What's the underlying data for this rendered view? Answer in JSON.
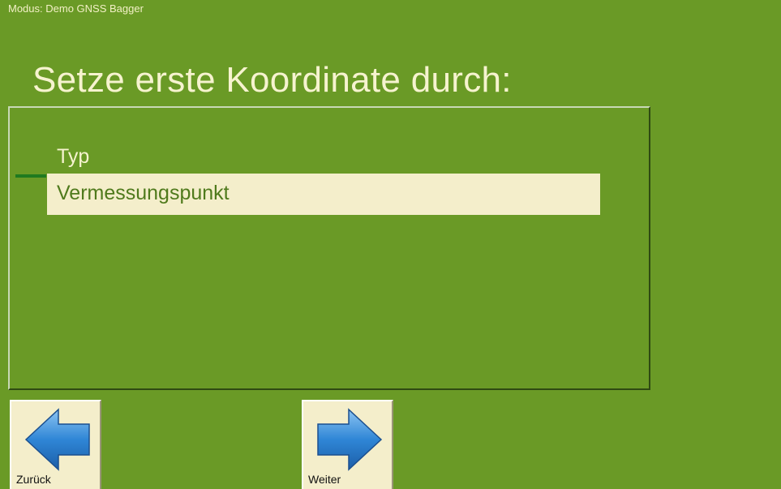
{
  "header": {
    "mode_text": "Modus: Demo GNSS Bagger"
  },
  "main": {
    "title": "Setze erste Koordinate durch:",
    "field": {
      "label": "Typ",
      "value": "Vermessungspunkt"
    }
  },
  "footer": {
    "back_label": "Zurück",
    "next_label": "Weiter"
  },
  "colors": {
    "background": "#6a9a26",
    "text_light": "#f6f3cf",
    "selection_bg": "#f4eecb",
    "selection_text": "#4f7a1c",
    "arrow_blue": "#2f86d6"
  },
  "icons": {
    "back": "arrow-left-icon",
    "next": "arrow-right-icon"
  }
}
